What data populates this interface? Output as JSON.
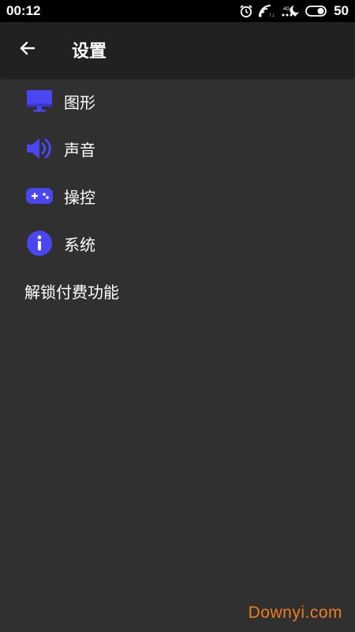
{
  "status_bar": {
    "time": "00:12",
    "battery": "50",
    "icons": [
      "alarm-icon",
      "wifi-icon",
      "signal-icon",
      "battery-icon"
    ]
  },
  "app_bar": {
    "back_icon": "arrow-left-icon",
    "title": "设置"
  },
  "menu": {
    "items": [
      {
        "label": "图形",
        "icon": "monitor-icon"
      },
      {
        "label": "声音",
        "icon": "speaker-icon"
      },
      {
        "label": "操控",
        "icon": "gamepad-icon"
      },
      {
        "label": "系统",
        "icon": "info-icon"
      },
      {
        "label": "解锁付费功能",
        "icon": ""
      }
    ]
  },
  "watermark": "Downyi.com",
  "colors": {
    "background": "#303030",
    "app_bar": "#212121",
    "status_bar": "#000000",
    "accent_icon": "#4a46f0",
    "text": "#ffffff",
    "watermark": "#f07d1e"
  }
}
